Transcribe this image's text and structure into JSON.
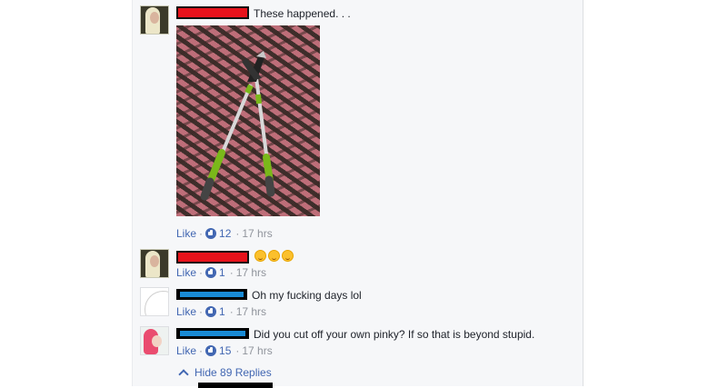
{
  "comments": [
    {
      "text": "These happened. . .",
      "like_label": "Like",
      "likes": "12",
      "time": "17 hrs",
      "has_photo": true
    },
    {
      "text": "",
      "emoji": [
        "smiling-face",
        "smiling-face",
        "smiling-face"
      ],
      "like_label": "Like",
      "likes": "1",
      "time": "17 hrs"
    },
    {
      "text": "Oh my fucking days lol",
      "like_label": "Like",
      "likes": "1",
      "time": "17 hrs"
    },
    {
      "text": "Did you cut off your own pinky? If so that is beyond stupid.",
      "like_label": "Like",
      "likes": "15",
      "time": "17 hrs"
    }
  ],
  "replies": {
    "toggle_label": "Hide 89 Replies"
  },
  "separator": "·",
  "colors": {
    "link": "#4267b2",
    "meta": "#90949c",
    "redaction_red": "#e8121b",
    "redaction_blue": "#198bd6"
  },
  "icons": [
    "like-thumb-icon",
    "chevron-up-icon",
    "smiling-face-emoji"
  ]
}
